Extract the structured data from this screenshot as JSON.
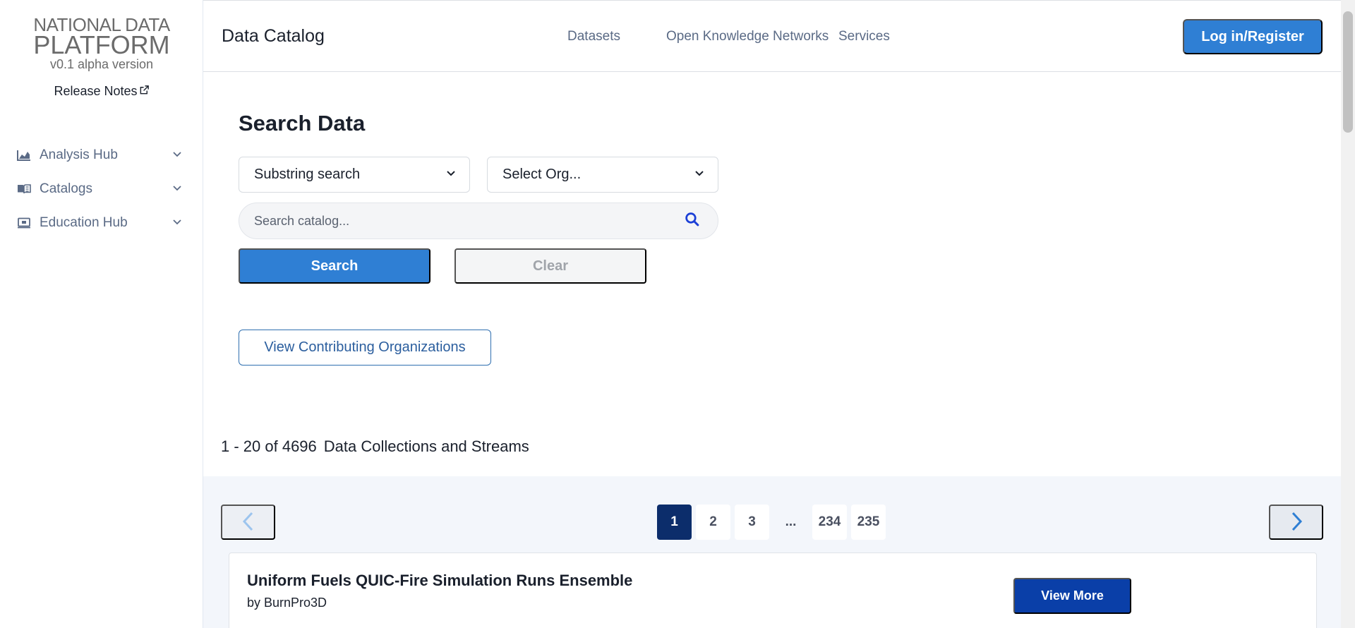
{
  "sidebar": {
    "logo": {
      "line1": "NATIONAL DATA",
      "line2": "PLATFORM",
      "line3": "v0.1 alpha version"
    },
    "release_notes": "Release Notes",
    "items": [
      {
        "label": "Analysis Hub",
        "icon": "chart-area-icon"
      },
      {
        "label": "Catalogs",
        "icon": "book-open-icon"
      },
      {
        "label": "Education Hub",
        "icon": "monitor-icon"
      }
    ]
  },
  "header": {
    "title": "Data Catalog",
    "nav": [
      "Datasets",
      "Open Knowledge Networks",
      "Services"
    ],
    "login_label": "Log in/Register"
  },
  "search": {
    "title": "Search Data",
    "mode_select": "Substring search",
    "org_select": "Select Org...",
    "placeholder": "Search catalog...",
    "search_label": "Search",
    "clear_label": "Clear",
    "contrib_label": "View Contributing Organizations"
  },
  "results": {
    "range": "1 - 20 of 4696",
    "label": "Data Collections and Streams",
    "pages": [
      "1",
      "2",
      "3",
      "...",
      "234",
      "235"
    ],
    "active_page": "1",
    "cards": [
      {
        "title": "Uniform Fuels QUIC-Fire Simulation Runs Ensemble",
        "by": "by BurnPro3D",
        "button": "View More"
      }
    ]
  },
  "colors": {
    "primary": "#2f7fd4",
    "active_page": "#0c2d6b",
    "view_more": "#0a3fa8",
    "nav_text": "#5a6a85"
  }
}
